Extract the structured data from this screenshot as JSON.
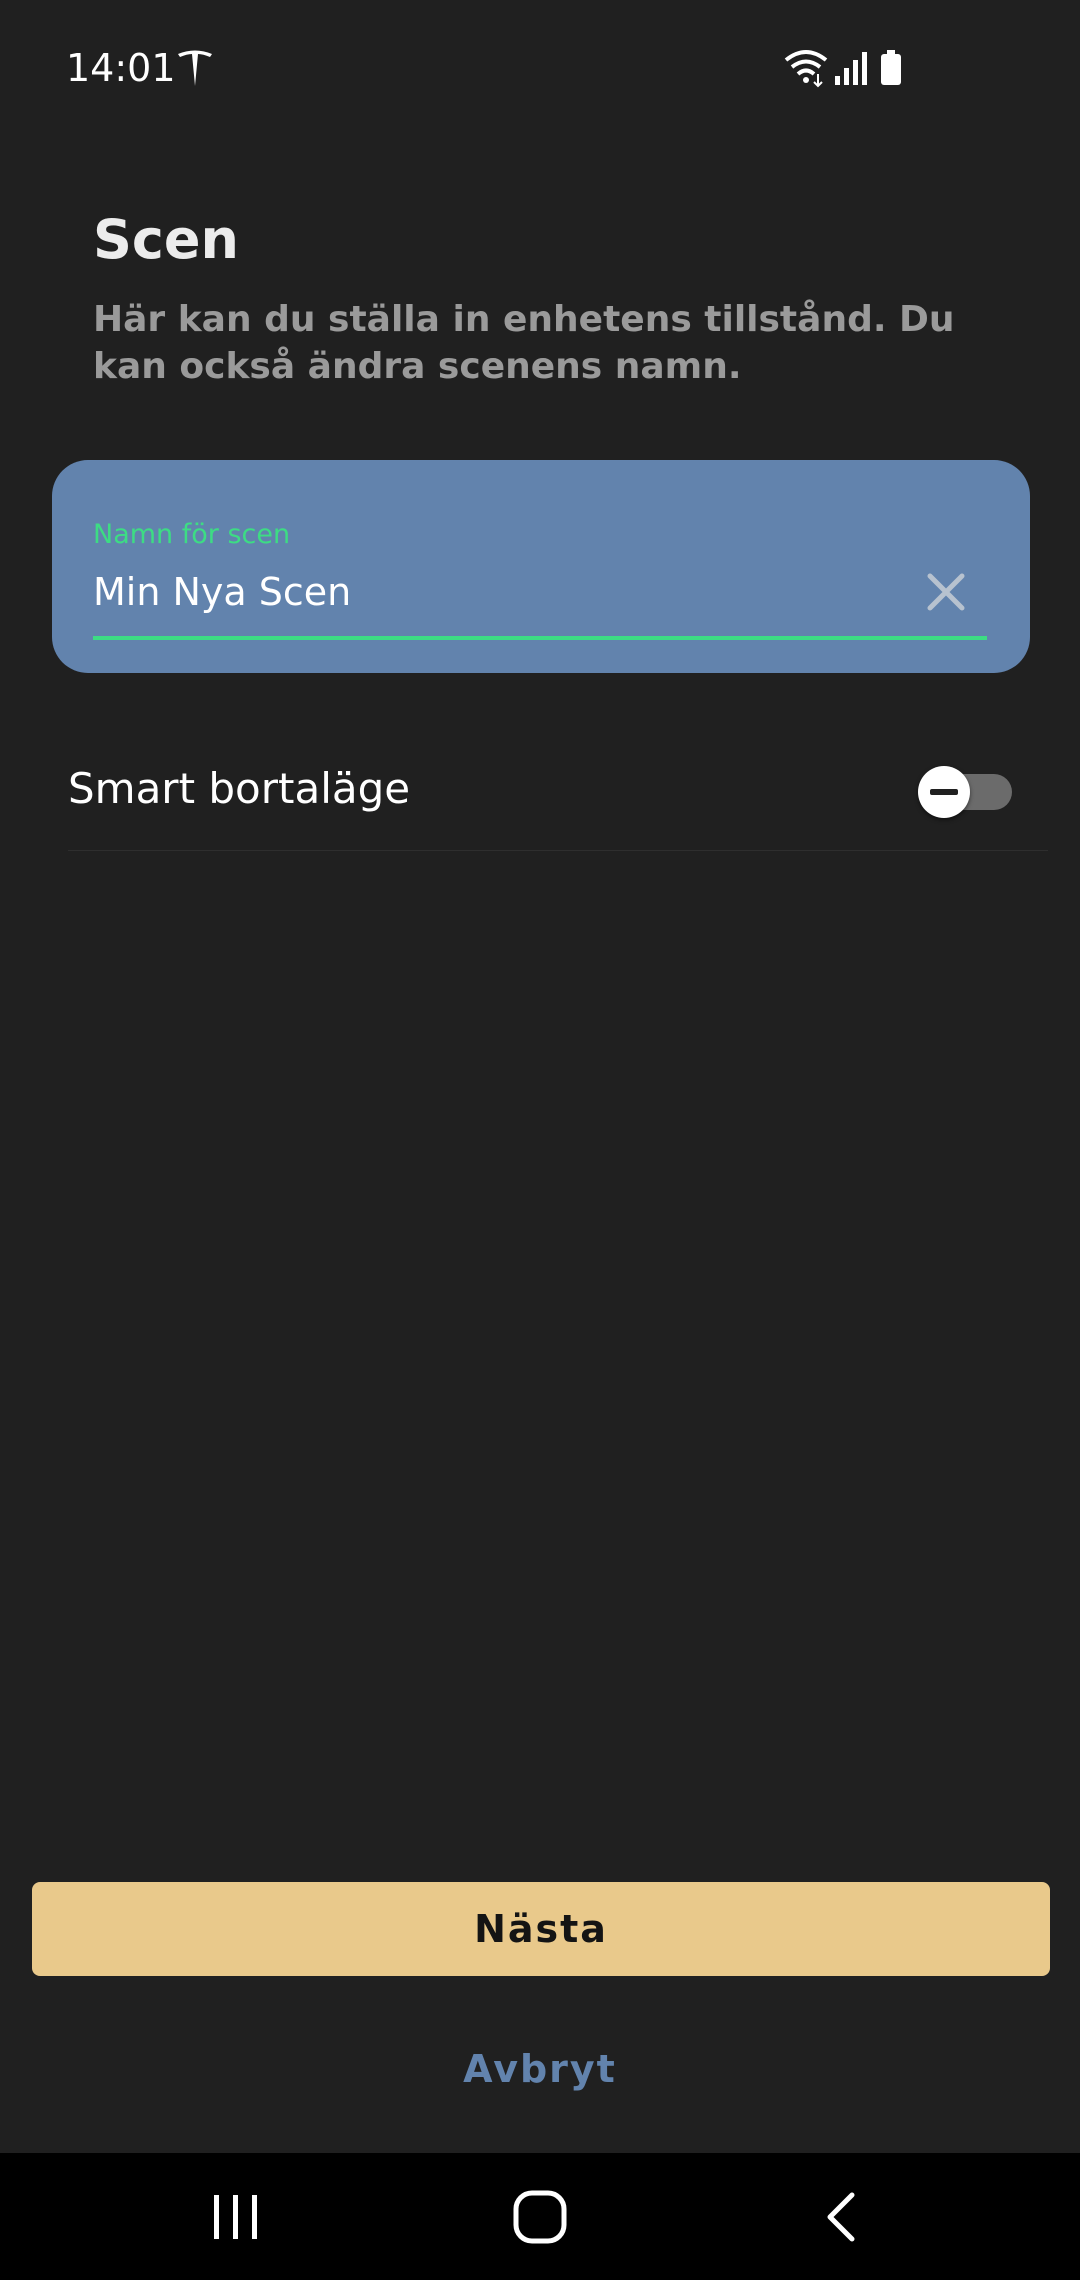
{
  "status_bar": {
    "time": "14:01",
    "icons": [
      "tesla-logo-icon",
      "wifi-icon",
      "signal-icon",
      "battery-icon"
    ]
  },
  "header": {
    "title": "Scen",
    "description": "Här kan du ställa in enhetens tillstånd. Du kan också ändra scenens namn."
  },
  "name_field": {
    "label": "Namn för scen",
    "value": "Min Nya Scen",
    "clear_icon": "close-icon"
  },
  "smart_away": {
    "label": "Smart bortaläge",
    "enabled": false
  },
  "actions": {
    "next_label": "Nästa",
    "cancel_label": "Avbryt"
  },
  "nav_bar": {
    "icons": [
      "recents-icon",
      "home-icon",
      "back-icon"
    ]
  },
  "colors": {
    "background": "#202020",
    "card": "#6283ad",
    "accent_green": "#3ddc84",
    "primary_button": "#e9c98b",
    "link_blue": "#6283ad"
  }
}
